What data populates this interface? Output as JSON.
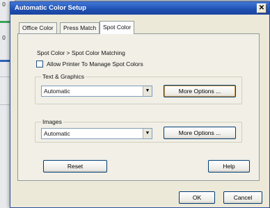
{
  "background": {
    "cells": [
      "0",
      "0"
    ]
  },
  "dialog": {
    "title": "Automatic Color Setup",
    "close_glyph": "✕",
    "tabs": [
      {
        "label": "Office Color",
        "active": false
      },
      {
        "label": "Press Match",
        "active": false
      },
      {
        "label": "Spot Color",
        "active": true
      }
    ],
    "breadcrumb": "Spot Color > Spot Color Matching",
    "allow_printer_checkbox": {
      "label": "Allow Printer To Manage Spot Colors",
      "checked": false
    },
    "text_graphics": {
      "legend": "Text & Graphics",
      "select_value": "Automatic",
      "more_options_label": "More Options ..."
    },
    "images": {
      "legend": "Images",
      "select_value": "Automatic",
      "more_options_label": "More Options ..."
    },
    "reset_label": "Reset",
    "help_label": "Help",
    "ok_label": "OK",
    "cancel_label": "Cancel",
    "dropdown_arrow_glyph": "▼"
  }
}
